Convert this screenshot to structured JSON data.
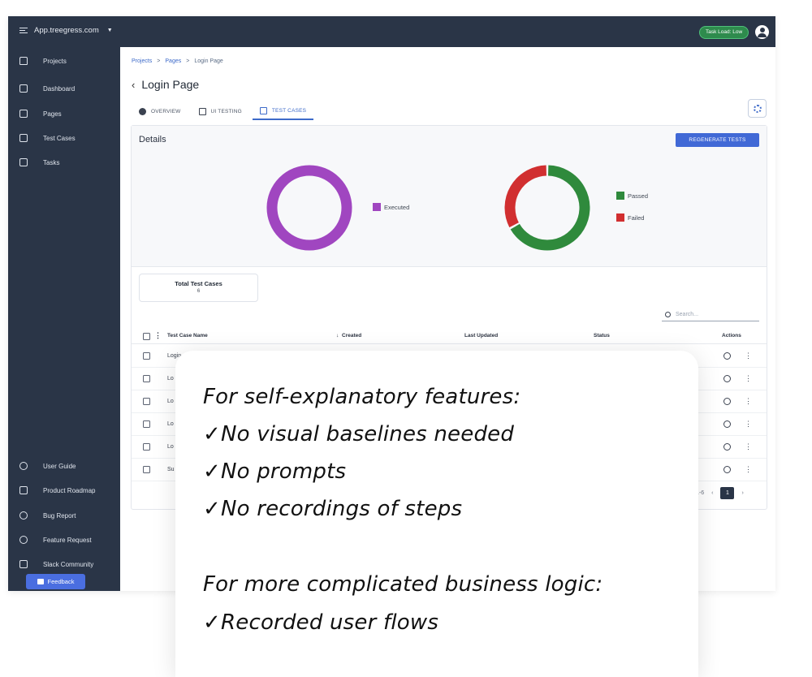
{
  "topbar": {
    "app_name": "App.treegress.com",
    "task_pill": "Task Load: Low"
  },
  "sidebar": {
    "items": [
      {
        "label": "Projects"
      },
      {
        "label": "Dashboard"
      },
      {
        "label": "Pages"
      },
      {
        "label": "Test Cases"
      },
      {
        "label": "Tasks"
      }
    ],
    "bottom_items": [
      {
        "label": "User Guide"
      },
      {
        "label": "Product Roadmap"
      },
      {
        "label": "Bug Report"
      },
      {
        "label": "Feature Request"
      },
      {
        "label": "Slack Community"
      }
    ],
    "feedback_label": "Feedback"
  },
  "breadcrumb": [
    "Projects",
    "Pages",
    "Login Page"
  ],
  "breadcrumb_separator": ">",
  "page": {
    "title": "Login Page",
    "tabs": [
      {
        "label": "OVERVIEW",
        "active": false
      },
      {
        "label": "UI TESTING",
        "active": false
      },
      {
        "label": "TEST CASES",
        "active": true
      }
    ]
  },
  "details": {
    "title": "Details",
    "regenerate_label": "REGENERATE TESTS",
    "charts": [
      {
        "type": "donut",
        "segments": [
          {
            "label": "Executed",
            "value": 100,
            "color": "#a046c0"
          }
        ]
      },
      {
        "type": "donut",
        "segments": [
          {
            "label": "Passed",
            "value": 67,
            "color": "#2f8a3c"
          },
          {
            "label": "Failed",
            "value": 33,
            "color": "#d12f30"
          }
        ]
      }
    ]
  },
  "total_card": {
    "label": "Total Test Cases",
    "value": "6"
  },
  "search": {
    "placeholder": "Search..."
  },
  "table": {
    "columns": [
      "Test Case Name",
      "Created",
      "Last Updated",
      "Status",
      "Actions"
    ],
    "rows": [
      {
        "name": "Login"
      },
      {
        "name": "Lo"
      },
      {
        "name": "Lo"
      },
      {
        "name": "Lo"
      },
      {
        "name": "Lo"
      },
      {
        "name": "Su"
      }
    ]
  },
  "pagination": {
    "range_text": "1-6",
    "current_page": "1"
  },
  "overlay": {
    "heading_1": "For self-explanatory features:",
    "items_1": [
      "✓No visual baselines needed",
      "✓No prompts",
      "✓No recordings of steps"
    ],
    "heading_2": "For more complicated business logic:",
    "items_2": [
      "✓Recorded user flows"
    ]
  }
}
